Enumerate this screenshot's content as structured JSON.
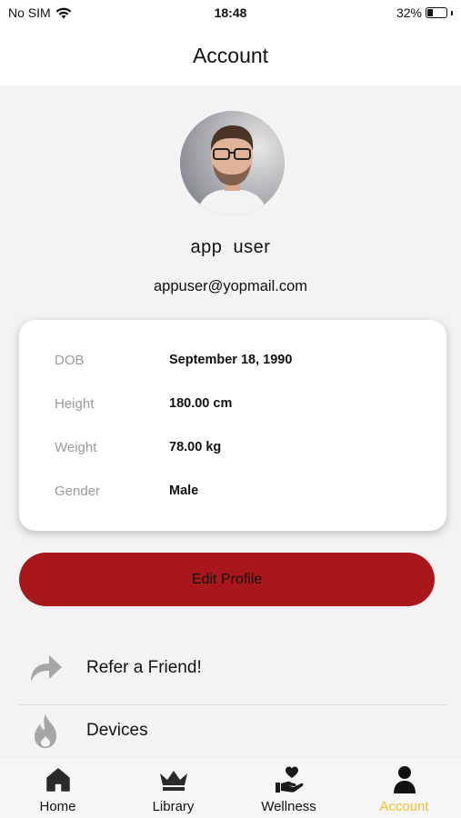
{
  "status_bar": {
    "carrier": "No SIM",
    "time": "18:48",
    "battery": "32%",
    "battery_level": 0.32
  },
  "header": {
    "title": "Account"
  },
  "profile": {
    "name": "app  user",
    "email": "appuser@yopmail.com"
  },
  "details": [
    {
      "label": "DOB",
      "value": "September 18, 1990"
    },
    {
      "label": "Height",
      "value": "180.00 cm"
    },
    {
      "label": "Weight",
      "value": "78.00 kg"
    },
    {
      "label": "Gender",
      "value": "Male"
    }
  ],
  "edit_button": {
    "label": "Edit Profile"
  },
  "menu": [
    {
      "label": "Refer a Friend!",
      "icon": "share-arrow-icon"
    },
    {
      "label": "Devices",
      "icon": "flame-icon"
    }
  ],
  "tabs": [
    {
      "label": "Home",
      "icon": "home-icon",
      "active": false
    },
    {
      "label": "Library",
      "icon": "crown-icon",
      "active": false
    },
    {
      "label": "Wellness",
      "icon": "heart-hand-icon",
      "active": false
    },
    {
      "label": "Account",
      "icon": "person-icon",
      "active": true
    }
  ],
  "colors": {
    "accent": "#a8171c",
    "active_tab": "#f2c230",
    "label_gray": "#9a9a9a",
    "background": "#f4f2f3"
  }
}
